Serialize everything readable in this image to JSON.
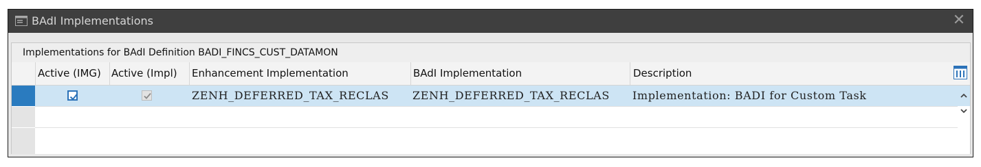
{
  "window": {
    "title": "BAdI Implementations",
    "close_label": "✕"
  },
  "table": {
    "caption": "Implementations for BAdI Definition BADI_FINCS_CUST_DATAMON",
    "columns": [
      "Active (IMG)",
      "Active (Impl)",
      "Enhancement Implementation",
      "BAdI Implementation",
      "Description"
    ],
    "rows": [
      {
        "active_img": true,
        "active_impl": true,
        "enhancement_implementation": "ZENH_DEFERRED_TAX_RECLAS",
        "badi_implementation": "ZENH_DEFERRED_TAX_RECLAS",
        "description": "Implementation: BADI for Custom Task"
      }
    ]
  },
  "icons": {
    "title": "window-menu-icon",
    "settings": "column-settings-icon",
    "scroll_up": "chevron-up-icon",
    "scroll_down": "chevron-down-icon"
  },
  "colors": {
    "titlebar": "#3f3f3f",
    "selected_row": "#cde4f4",
    "selected_marker": "#2a7bbf"
  }
}
